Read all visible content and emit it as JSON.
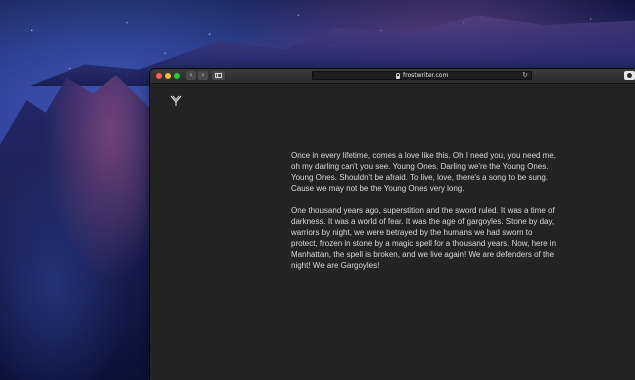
{
  "browser": {
    "url": "frostwriter.com"
  },
  "article": {
    "paragraphs": [
      "Once in every lifetime, comes a love like this. Oh I need you, you need me, oh my darling can't you see. Young Ones. Darling we're the Young Ones. Young Ones. Shouldn't be afraid. To live, love, there's a song to be sung. Cause we may not be the Young Ones very long.",
      "One thousand years ago, superstition and the sword ruled. It was a time of darkness. It was a world of fear. It was the age of gargoyles. Stone by day, warriors by night, we were betrayed by the humans we had sworn to protect, frozen in stone by a magic spell for a thousand years. Now, here in Manhattan, the spell is broken, and we live again! We are defenders of the night! We are Gargoyles!"
    ]
  },
  "icons": {
    "back": "chevron-left-icon",
    "forward": "chevron-right-icon",
    "sidebar": "sidebar-icon",
    "lock": "lock-icon",
    "reload": "reload-icon",
    "extension": "extension-icon",
    "logo": "site-logo"
  },
  "colors": {
    "window_background": "#232323",
    "toolbar_background": "#2f2f2f",
    "text": "#d9d9d9",
    "close": "#ff5f57",
    "minimize": "#febc2e",
    "zoom": "#28c840"
  }
}
